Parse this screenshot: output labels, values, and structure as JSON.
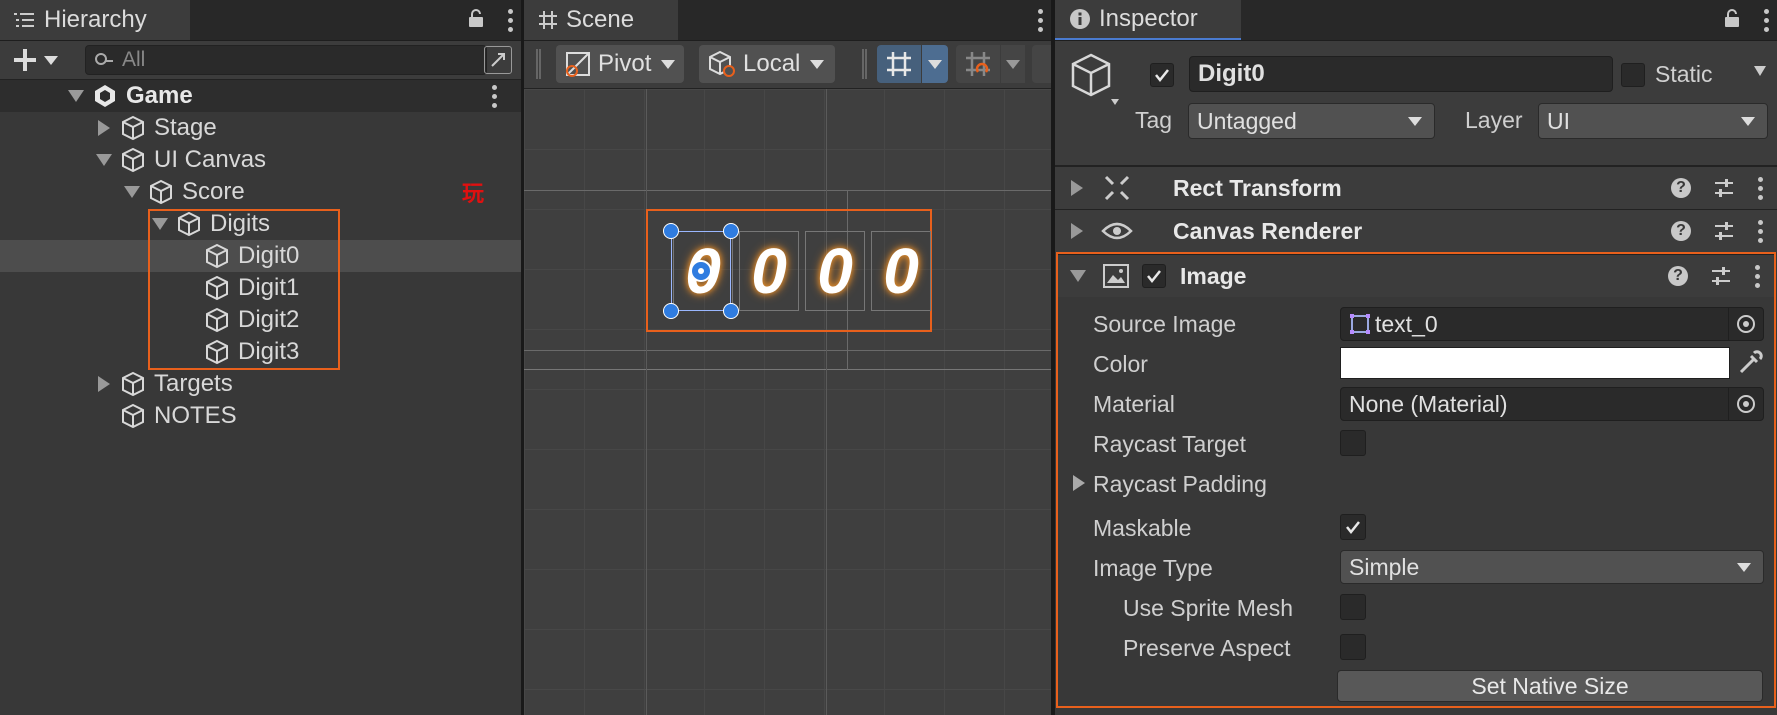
{
  "hierarchy": {
    "tab_title": "Hierarchy",
    "search_placeholder": "All",
    "items": [
      {
        "label": "Game"
      },
      {
        "label": "Stage"
      },
      {
        "label": "UI Canvas"
      },
      {
        "label": "Score"
      },
      {
        "label": "Digits"
      },
      {
        "label": "Digit0"
      },
      {
        "label": "Digit1"
      },
      {
        "label": "Digit2"
      },
      {
        "label": "Digit3"
      },
      {
        "label": "Targets"
      },
      {
        "label": "NOTES"
      }
    ],
    "score_badge": "玩"
  },
  "scene": {
    "tab_title": "Scene",
    "pivot_label": "Pivot",
    "local_label": "Local",
    "digits": [
      "0",
      "0",
      "0",
      "0"
    ]
  },
  "inspector": {
    "tab_title": "Inspector",
    "object_name": "Digit0",
    "static_label": "Static",
    "tag_label": "Tag",
    "tag_value": "Untagged",
    "layer_label": "Layer",
    "layer_value": "UI",
    "components": {
      "rect_transform": "Rect Transform",
      "canvas_renderer": "Canvas Renderer",
      "image": "Image"
    },
    "image": {
      "source_image_label": "Source Image",
      "source_image_value": "text_0",
      "color_label": "Color",
      "color_value": "#ffffff",
      "material_label": "Material",
      "material_value": "None (Material)",
      "raycast_target_label": "Raycast Target",
      "raycast_padding_label": "Raycast Padding",
      "maskable_label": "Maskable",
      "image_type_label": "Image Type",
      "image_type_value": "Simple",
      "use_sprite_mesh_label": "Use Sprite Mesh",
      "preserve_aspect_label": "Preserve Aspect",
      "set_native_size_label": "Set Native Size"
    }
  },
  "colors": {
    "highlight_orange": "#e8601c",
    "selection_blue": "#2f7ce0"
  }
}
